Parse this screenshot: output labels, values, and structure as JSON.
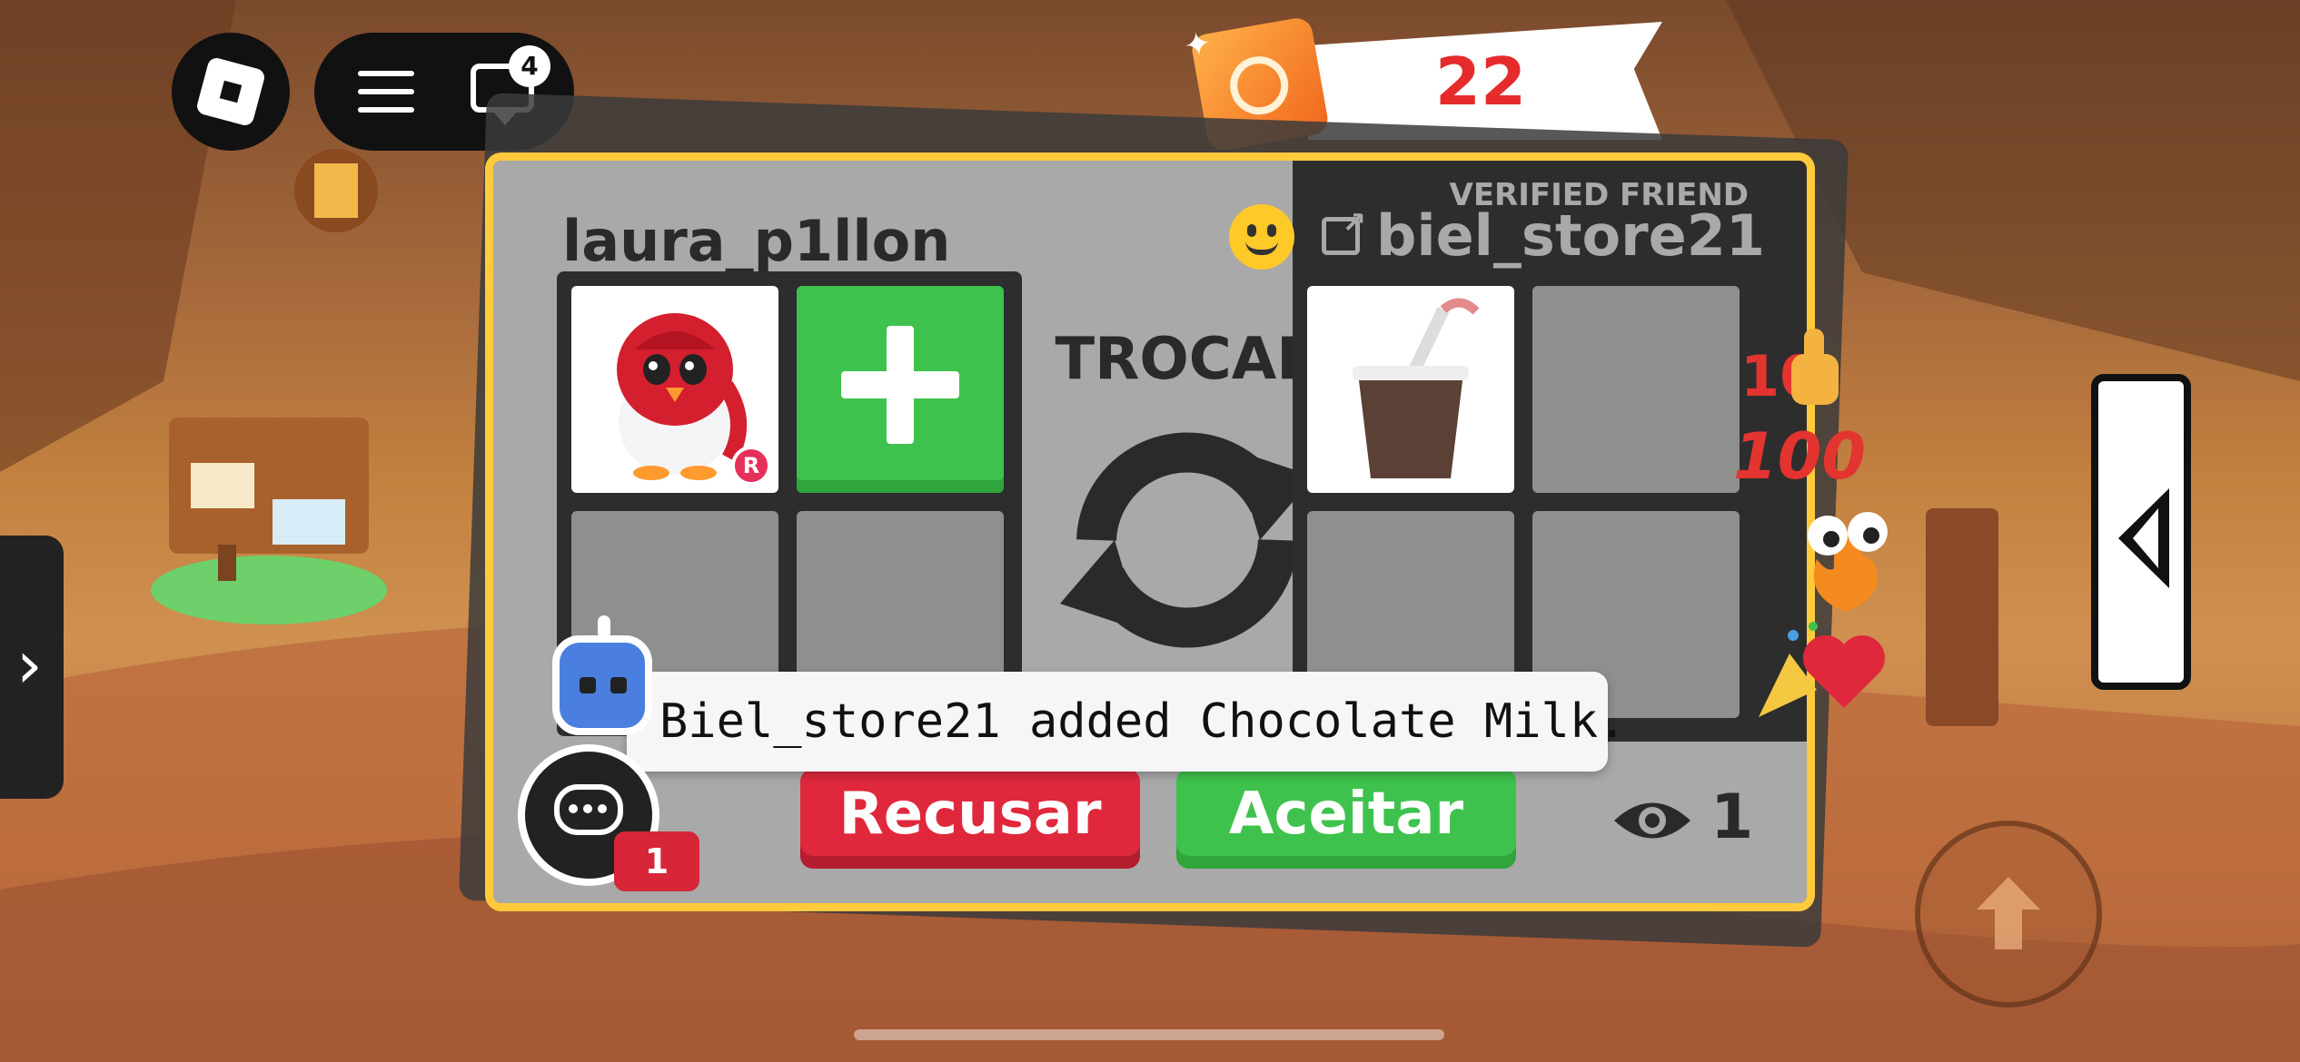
{
  "top_bar": {
    "chat_unread": "4",
    "banner_count": "22"
  },
  "trade": {
    "my_name": "laura_p1llon",
    "partner_name": "biel_store21",
    "partner_badge": "VERIFIED FRIEND",
    "center_label": "TROCAR",
    "my_items": [
      {
        "name": "penguin pet",
        "rarity_badge": "R"
      },
      {
        "name": "add item"
      },
      {
        "name": "empty"
      },
      {
        "name": "empty"
      }
    ],
    "partner_items": [
      {
        "name": "Chocolate Milk"
      },
      {
        "name": "empty"
      },
      {
        "name": "empty"
      },
      {
        "name": "empty"
      }
    ],
    "decline_label": "Recusar",
    "accept_label": "Aceitar",
    "viewer_count": "1"
  },
  "notification": {
    "message": "Biel_store21 added Chocolate Milk."
  },
  "chat": {
    "unread": "1"
  },
  "reactions": [
    "thumbs-up",
    "hundred",
    "eyes-fire",
    "party-heart"
  ],
  "reaction_text": {
    "hundred": "100"
  },
  "colors": {
    "panel_border": "#ffcb3d",
    "accept": "#3fc24d",
    "decline": "#e0283d",
    "banner_count": "#e52b2b"
  }
}
